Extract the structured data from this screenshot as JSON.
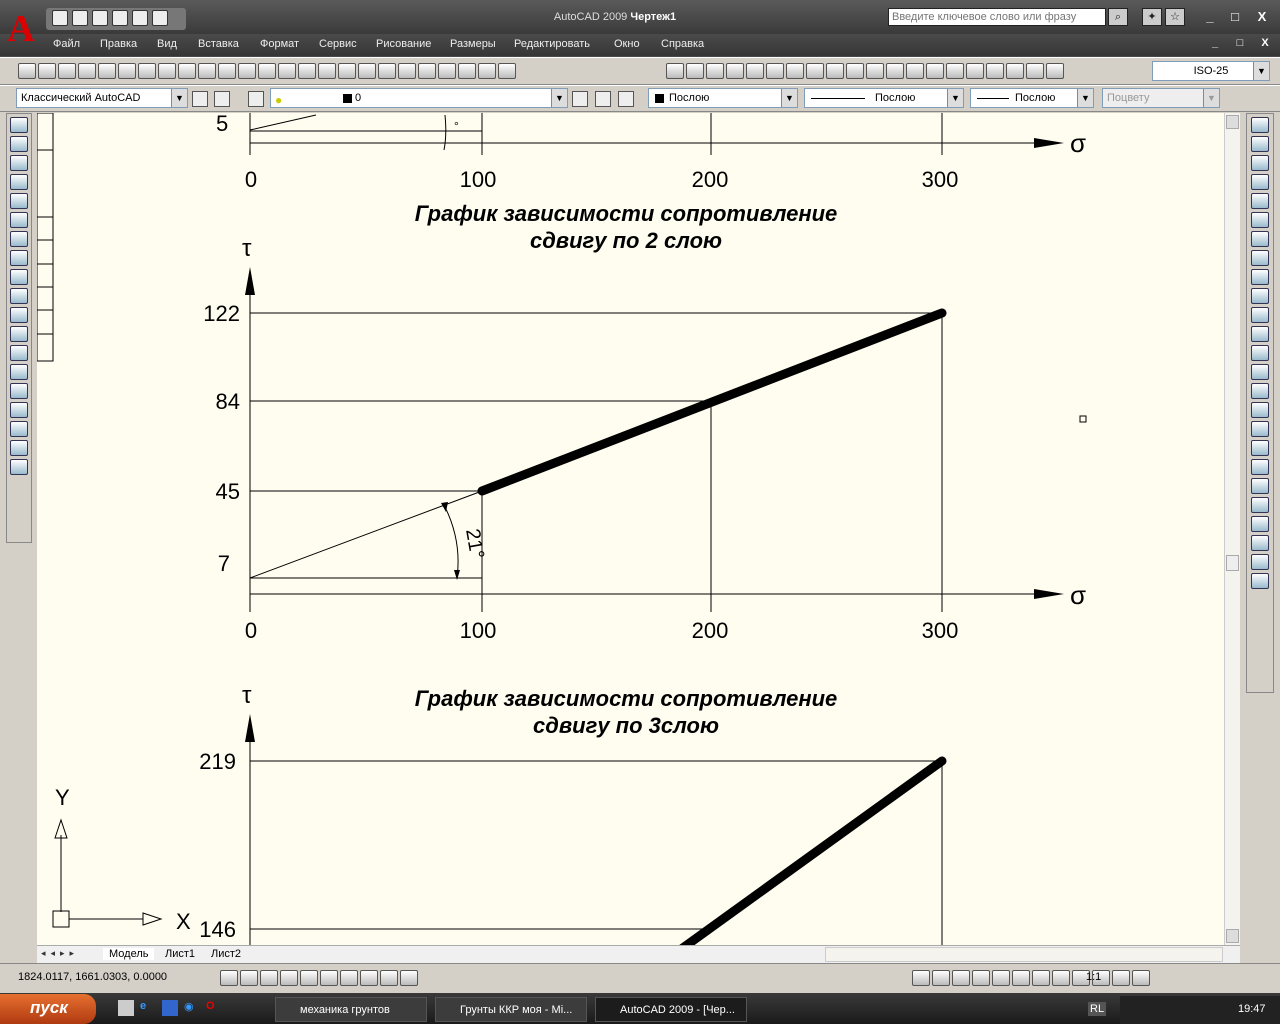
{
  "window": {
    "app": "AutoCAD 2009",
    "doc": "Чертеж1",
    "search_placeholder": "Введите ключевое слово или фразу"
  },
  "menu": [
    "Файл",
    "Правка",
    "Вид",
    "Вставка",
    "Формат",
    "Сервис",
    "Рисование",
    "Размеры",
    "Редактировать",
    "Окно",
    "Справка"
  ],
  "toolbar": {
    "dimstyle": "ISO-25",
    "workspace": "Классический AutoCAD",
    "layer": "0",
    "color": "Послою",
    "linetype": "Послою",
    "lineweight": "Послою",
    "plotstyle": "Поцвету"
  },
  "icons": {
    "standard": [
      "new-icon",
      "open-icon",
      "save-icon",
      "print-icon",
      "preview-icon",
      "plot-icon",
      "publish-icon",
      "cut-icon",
      "copy-icon",
      "paste-icon",
      "match-icon",
      "brush-icon",
      "undo-icon",
      "redo-icon",
      "pan-icon",
      "zoom-realtime-icon",
      "zoom-window-icon",
      "zoom-previous-icon",
      "properties-icon",
      "design-center-icon",
      "tool-palettes-icon",
      "sheetset-icon",
      "markup-icon",
      "calc-icon",
      "help-icon"
    ],
    "dimension": [
      "dim-linear-icon",
      "dim-aligned-icon",
      "dim-arc-icon",
      "dim-ordinate-icon",
      "dim-radius-icon",
      "dim-jogged-icon",
      "dim-diameter-icon",
      "dim-angular-icon",
      "quick-dim-icon",
      "dim-baseline-icon",
      "dim-continue-icon",
      "dim-space-icon",
      "dim-break-icon",
      "tolerance-icon",
      "center-mark-icon",
      "inspect-icon",
      "jogged-linear-icon",
      "dim-edit-icon",
      "dim-text-edit-icon",
      "dim-update-icon"
    ],
    "left": [
      "line-icon",
      "construction-line-icon",
      "polyline-icon",
      "polygon-icon",
      "rectangle-icon",
      "arc-icon",
      "circle-icon",
      "revcloud-icon",
      "spline-icon",
      "ellipse-icon",
      "ellipse-arc-icon",
      "insert-block-icon",
      "make-block-icon",
      "point-icon",
      "hatch-icon",
      "gradient-icon",
      "region-icon",
      "table-icon",
      "mtext-icon"
    ],
    "right": [
      "erase-icon",
      "copy-object-icon",
      "mirror-icon",
      "offset-icon",
      "array-icon",
      "move-icon",
      "rotate-icon",
      "scale-icon",
      "stretch-icon",
      "trim-icon",
      "extend-icon",
      "break-at-point-icon",
      "break-icon",
      "join-icon",
      "chamfer-icon",
      "fillet-icon",
      "explode-icon",
      "draworder-front-icon",
      "draworder-back-icon",
      "draworder-above-icon",
      "draworder-under-icon",
      "text-style-icon",
      "dim-style-icon",
      "table-style-icon",
      "multileader-style-icon"
    ]
  },
  "drawing": {
    "sigma": "σ",
    "tau": "τ",
    "top": {
      "y_label": "5",
      "x_ticks": [
        "0",
        "100",
        "200",
        "300"
      ],
      "angle": "°"
    },
    "chart2": {
      "title1": "График зависимости сопротивление",
      "title2": "сдвигу по 2 слою",
      "y_ticks": [
        "122",
        "84",
        "45",
        "7"
      ],
      "x_ticks": [
        "0",
        "100",
        "200",
        "300"
      ],
      "angle": "21°"
    },
    "chart3": {
      "title1": "График зависимости сопротивление",
      "title2": "сдвигу по 3слою",
      "y_ticks": [
        "219",
        "146"
      ]
    },
    "ucs": {
      "x": "X",
      "y": "Y"
    }
  },
  "chart_data": [
    {
      "type": "line",
      "title": "График зависимости сопротивление сдвигу по 2 слою",
      "xlabel": "σ",
      "ylabel": "τ",
      "x": [
        0,
        100,
        200,
        300
      ],
      "y": [
        7,
        45,
        84,
        122
      ],
      "xlim": [
        0,
        300
      ]
    },
    {
      "type": "line",
      "title": "График зависимости сопротивление сдвигу по 3слою",
      "xlabel": "σ",
      "ylabel": "τ",
      "y_ticks": [
        146,
        219
      ],
      "x": [
        300
      ],
      "y": [
        219
      ]
    }
  ],
  "tabs": [
    "Модель",
    "Лист1",
    "Лист2"
  ],
  "status": {
    "coords": "1824.0117, 1661.0303, 0.0000",
    "scale": "1:1"
  },
  "taskbar": {
    "start": "пуск",
    "tasks": [
      "механика грунтов",
      "Грунты ККР моя - Mi...",
      "AutoCAD 2009 - [Чер..."
    ],
    "lang": "RL",
    "clock": "19:47"
  }
}
